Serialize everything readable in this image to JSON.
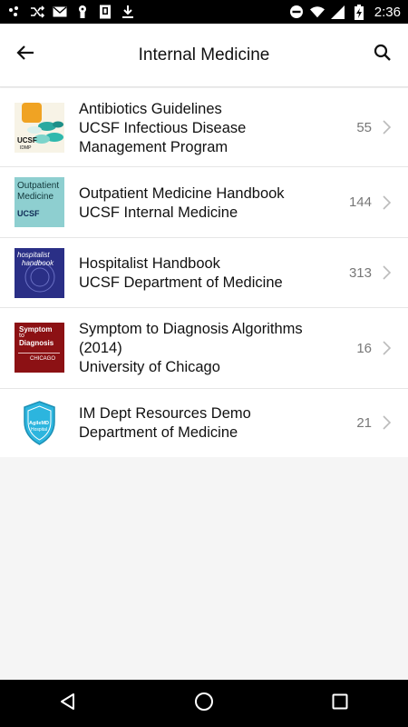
{
  "status_bar": {
    "time": "2:36",
    "icons": [
      "notification-dots-icon",
      "shuffle-icon",
      "mail-icon",
      "keyhole-icon",
      "storage-icon",
      "download-icon",
      "do-not-disturb-icon",
      "wifi-icon",
      "signal-icon",
      "battery-charging-icon"
    ]
  },
  "header": {
    "title": "Internal Medicine",
    "back_icon": "arrow-left-icon",
    "search_icon": "search-icon"
  },
  "items": [
    {
      "lines": [
        "Antibiotics Guidelines",
        "UCSF Infectious Disease",
        "Management Program"
      ],
      "count": "55",
      "thumb_text": [
        "UCSF",
        "IDMP"
      ]
    },
    {
      "lines": [
        "Outpatient Medicine Handbook",
        "UCSF Internal Medicine"
      ],
      "count": "144",
      "thumb_text": [
        "Outpatient",
        "Medicine",
        "UCSF"
      ]
    },
    {
      "lines": [
        "Hospitalist Handbook",
        "UCSF Department of Medicine"
      ],
      "count": "313",
      "thumb_text": [
        "hospitalist",
        "handbook"
      ]
    },
    {
      "lines": [
        "Symptom to Diagnosis Algorithms",
        "(2014)",
        "University of Chicago"
      ],
      "count": "16",
      "thumb_text": [
        "Symptom",
        "to",
        "Diagnosis",
        "CHICAGO"
      ]
    },
    {
      "lines": [
        "IM Dept Resources Demo",
        "Department of Medicine"
      ],
      "count": "21",
      "thumb_text": [
        "AgileMD",
        "Hospital"
      ]
    }
  ],
  "nav_bar": {
    "icons": [
      "back-triangle-icon",
      "home-circle-icon",
      "recents-square-icon"
    ]
  },
  "colors": {
    "status_bar": "#000000",
    "app_bar": "#ffffff",
    "background": "#f5f5f5",
    "count_text": "#777777",
    "chevron": "#bbbbbb"
  }
}
